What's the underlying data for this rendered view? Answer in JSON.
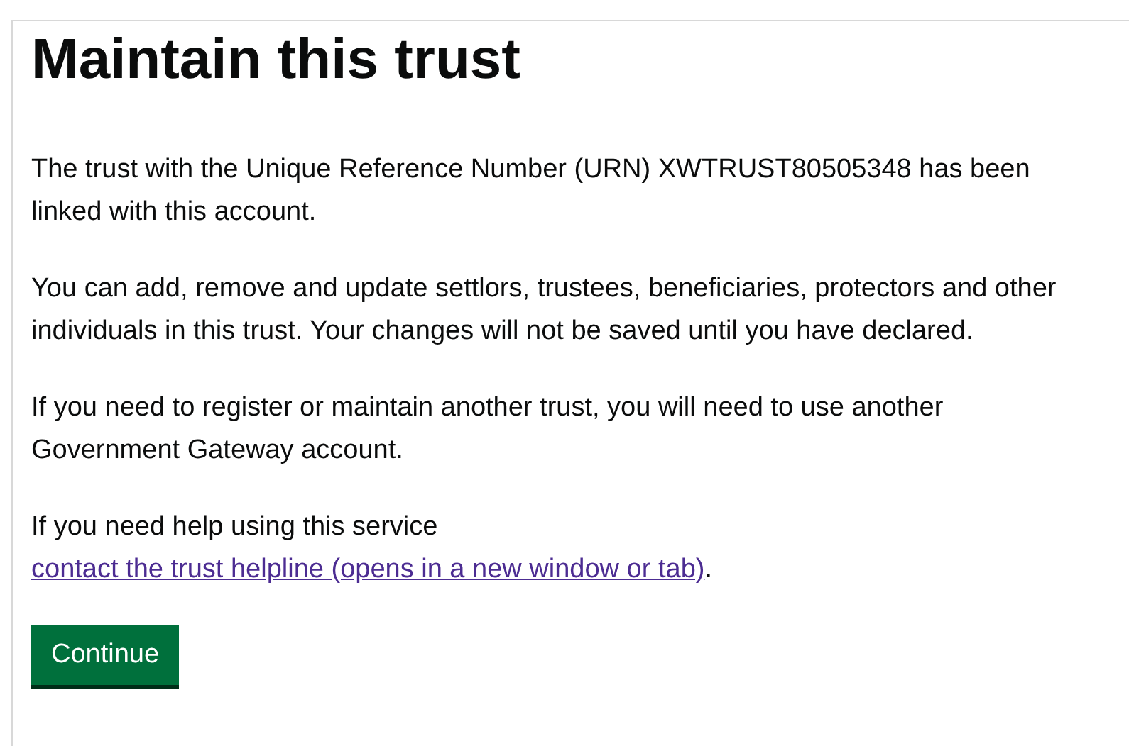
{
  "heading": "Maintain this trust",
  "paragraphs": [
    {
      "text": "The trust with the Unique Reference Number (URN) XWTRUST80505348 has been linked with this account."
    },
    {
      "text": "You can add, remove and update settlors, trustees, beneficiaries, protectors and other individuals in this trust. Your changes will not be saved until you have declared."
    },
    {
      "text": "If you need to register or maintain another trust, you will need to use another Government Gateway account."
    }
  ],
  "help": {
    "text": "If you need help using this service",
    "link": {
      "label": "contact the trust helpline (opens in a new window or tab)",
      "visited": true
    },
    "after": "."
  },
  "button": {
    "label": "Continue"
  }
}
